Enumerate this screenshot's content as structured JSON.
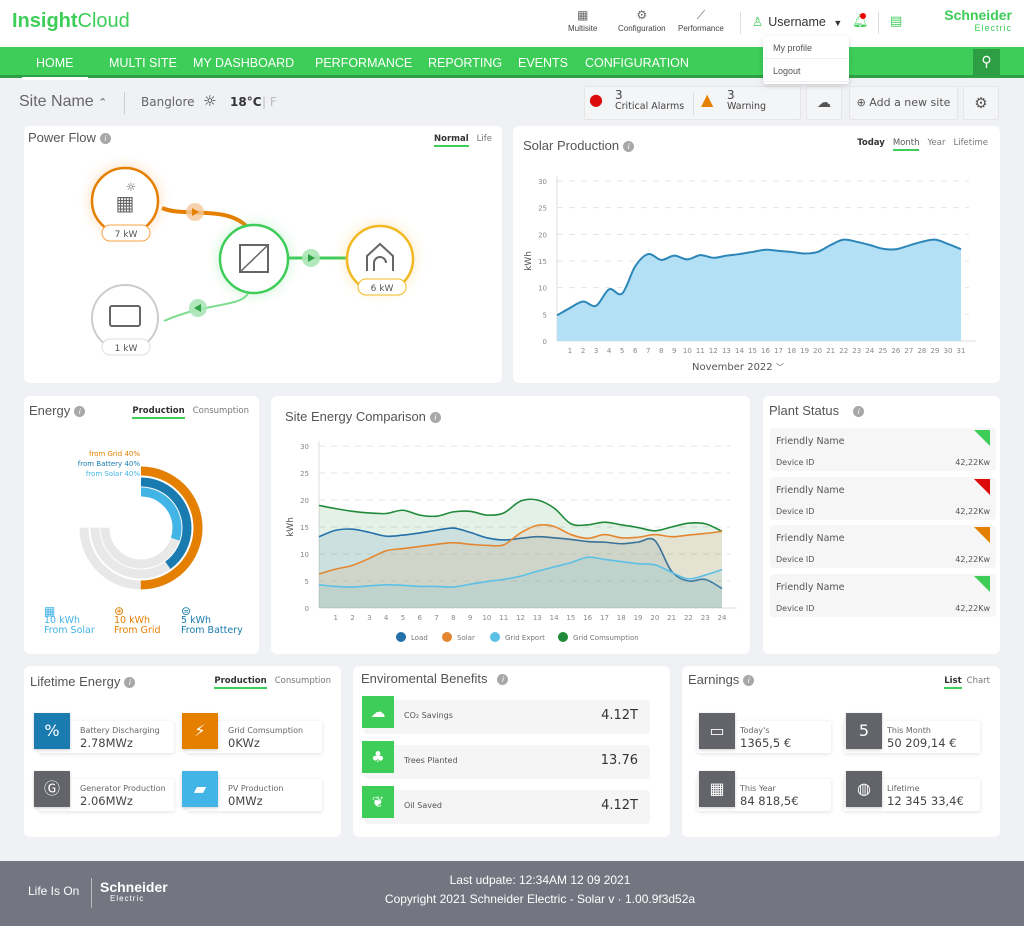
{
  "header": {
    "app_name_bold": "Insight",
    "app_name_light": "Cloud",
    "tools": [
      {
        "label": "Multisite",
        "icon": "multisite-icon"
      },
      {
        "label": "Configuration",
        "icon": "gear-icon"
      },
      {
        "label": "Performance",
        "icon": "chart-icon"
      }
    ],
    "username": "Username",
    "brand_top": "Schneider",
    "brand_bottom": "Electric",
    "user_menu": [
      "My profile",
      "Logout"
    ]
  },
  "nav": {
    "items": [
      "HOME",
      "MULTI SITE",
      "MY DASHBOARD",
      "PERFORMANCE",
      "REPORTING",
      "EVENTS",
      "CONFIGURATION"
    ],
    "active": "HOME"
  },
  "subbar": {
    "site_name": "Site Name",
    "city": "Banglore",
    "temperature": "18°C",
    "alt_unit": "| F",
    "critical_count": "3",
    "critical_label": "Critical Alarms",
    "warning_count": "3",
    "warning_label": "Warning",
    "add_site": "Add a new site"
  },
  "power_flow": {
    "title": "Power Flow",
    "tabs": [
      "Normal",
      "Life"
    ],
    "active_tab": "Normal",
    "solar": "7 kW",
    "home": "6 kW",
    "battery": "1 kW"
  },
  "solar_production": {
    "title": "Solar Production",
    "tabs": [
      "Today",
      "Month",
      "Year",
      "Lifetime"
    ],
    "active_tab": "Month",
    "period": "November 2022"
  },
  "energy": {
    "title": "Energy",
    "tabs": [
      "Production",
      "Consumption"
    ],
    "active_tab": "Production",
    "rings": [
      {
        "label": "40% from Grid",
        "percent": 50,
        "color": "#e47f00"
      },
      {
        "label": "40% from Battery",
        "percent": 40,
        "color": "#1a7bb0"
      },
      {
        "label": "40% from Solar",
        "percent": 30,
        "color": "#42b4e6"
      }
    ],
    "sources": [
      {
        "value": "10 kWh",
        "label": "From Solar",
        "color": "#42b4e6"
      },
      {
        "value": "10 kWh",
        "label": "From Grid",
        "color": "#e47f00"
      },
      {
        "value": "5 kWh",
        "label": "From Battery",
        "color": "#1a7bb0"
      }
    ]
  },
  "site_energy": {
    "title": "Site Energy Comparison"
  },
  "plant_status": {
    "title": "Plant Status",
    "items": [
      {
        "name": "Friendly Name",
        "device": "Device ID",
        "power": "42,22Kw",
        "status": "ok",
        "color": "#3dcd58"
      },
      {
        "name": "Friendly Name",
        "device": "Device ID",
        "power": "42,22Kw",
        "status": "error",
        "color": "#dc0a0a"
      },
      {
        "name": "Friendly Name",
        "device": "Device ID",
        "power": "42,22Kw",
        "status": "warning",
        "color": "#e47f00"
      },
      {
        "name": "Friendly Name",
        "device": "Device ID",
        "power": "42,22Kw",
        "status": "ok",
        "color": "#3dcd58"
      }
    ]
  },
  "lifetime_energy": {
    "title": "Lifetime Energy",
    "tabs": [
      "Production",
      "Consumption"
    ],
    "active_tab": "Production",
    "tiles": [
      {
        "label": "Battery Discharging",
        "value": "2.78MWz",
        "color": "#1a7bb0",
        "icon": "battery-percent-icon"
      },
      {
        "label": "Grid Comsumption",
        "value": "0KWz",
        "color": "#e47f00",
        "icon": "power-tower-icon"
      },
      {
        "label": "Generator Production",
        "value": "2.06MWz",
        "color": "#626469",
        "icon": "generator-icon"
      },
      {
        "label": "PV Production",
        "value": "0MWz",
        "color": "#42b4e6",
        "icon": "solar-panel-icon"
      }
    ]
  },
  "env_benefits": {
    "title": "Enviromental Benefits",
    "rows": [
      {
        "label": "CO₂ Savings",
        "value": "4.12T",
        "icon": "co2-factory-icon"
      },
      {
        "label": "Trees Planted",
        "value": "13.76",
        "icon": "tree-icon"
      },
      {
        "label": "Oil Saved",
        "value": "4.12T",
        "icon": "leaf-icon"
      }
    ]
  },
  "earnings": {
    "title": "Earnings",
    "tabs": [
      "List",
      "Chart"
    ],
    "active_tab": "List",
    "tiles": [
      {
        "label": "Today's",
        "value": "1365,5  €",
        "icon": "calendar-icon"
      },
      {
        "label": "This Month",
        "value": "50 209,14 €",
        "icon": "calendar-month-icon"
      },
      {
        "label": "This Year",
        "value": "84 818,5€",
        "icon": "grid-calendar-icon"
      },
      {
        "label": "Lifetime",
        "value": "12 345 33,4€",
        "icon": "globe-icon"
      }
    ]
  },
  "footer": {
    "tagline": "Life Is On",
    "brand_top": "Schneider",
    "brand_bottom": "Electric",
    "last_update": "Last udpate: 12:34AM 12 09 2021",
    "copyright": "Copyright 2021 Schneider Electric - Solar v · 1.00.9f3d52a"
  },
  "chart_data": [
    {
      "type": "area",
      "title": "Solar Production",
      "xlabel": "November 2022",
      "ylabel": "kWh",
      "ylim": [
        0,
        30
      ],
      "yticks": [
        0,
        5,
        10,
        15,
        20,
        25,
        30
      ],
      "grid": true,
      "x": [
        0,
        1,
        2,
        3,
        4,
        5,
        6,
        7,
        8,
        9,
        10,
        11,
        12,
        13,
        14,
        15,
        16,
        17,
        18,
        19,
        20,
        21,
        22,
        23,
        24,
        25,
        26,
        27,
        28,
        29,
        30,
        31
      ],
      "xticks": [
        1,
        2,
        3,
        4,
        5,
        6,
        7,
        8,
        9,
        10,
        11,
        12,
        13,
        14,
        15,
        16,
        17,
        18,
        19,
        20,
        21,
        22,
        23,
        24,
        25,
        26,
        27,
        28,
        29,
        30,
        31
      ],
      "series": [
        {
          "name": "Solar",
          "color": "#2d86b8",
          "fill": "#b3e0f5",
          "values": [
            4.8,
            6.2,
            7.4,
            6.6,
            9.7,
            8.9,
            14.0,
            16.3,
            15.2,
            16.0,
            15.3,
            16.1,
            15.6,
            16.0,
            16.3,
            16.7,
            17.1,
            16.9,
            16.7,
            16.4,
            16.7,
            18.0,
            19.0,
            18.6,
            18.0,
            17.3,
            17.2,
            17.9,
            18.6,
            19.0,
            18.2,
            17.2
          ]
        }
      ]
    },
    {
      "type": "area",
      "title": "Site Energy Comparison",
      "xlabel": "",
      "ylabel": "kWh",
      "ylim": [
        0,
        30
      ],
      "yticks": [
        0,
        5,
        10,
        15,
        20,
        25,
        30
      ],
      "grid": true,
      "legend": "bottom",
      "x": [
        0,
        1,
        2,
        3,
        4,
        5,
        6,
        7,
        8,
        9,
        10,
        11,
        12,
        13,
        14,
        15,
        16,
        17,
        18,
        19,
        20,
        21,
        22,
        23,
        24
      ],
      "xticks": [
        1,
        2,
        3,
        4,
        5,
        6,
        7,
        8,
        9,
        10,
        11,
        12,
        13,
        14,
        15,
        16,
        17,
        18,
        19,
        20,
        21,
        22,
        23,
        24
      ],
      "series": [
        {
          "name": "Grid Comsumption",
          "color": "#1f8a3a",
          "values": [
            19.0,
            18.4,
            17.9,
            17.6,
            17.5,
            18.1,
            17.2,
            17.0,
            17.8,
            17.9,
            17.2,
            17.6,
            19.8,
            20.0,
            18.5,
            15.6,
            15.4,
            15.9,
            15.4,
            14.9,
            14.3,
            15.0,
            15.7,
            15.6,
            14.2
          ]
        },
        {
          "name": "Load",
          "color": "#2470a8",
          "values": [
            13.2,
            14.4,
            14.6,
            14.0,
            13.3,
            13.5,
            13.9,
            14.4,
            14.8,
            14.0,
            13.0,
            12.6,
            12.9,
            13.2,
            13.0,
            12.7,
            12.3,
            12.2,
            11.9,
            12.2,
            12.5,
            6.8,
            5.0,
            5.3,
            3.6
          ]
        },
        {
          "name": "Solar",
          "color": "#e48630",
          "values": [
            6.3,
            7.2,
            7.9,
            9.2,
            10.6,
            11.0,
            11.4,
            11.8,
            12.1,
            11.8,
            11.6,
            11.7,
            13.9,
            15.3,
            15.1,
            13.6,
            12.9,
            13.6,
            13.0,
            13.1,
            13.6,
            13.2,
            13.5,
            13.8,
            14.2
          ]
        },
        {
          "name": "Grid Export",
          "color": "#5bc0e6",
          "values": [
            4.3,
            4.0,
            3.9,
            4.1,
            4.3,
            4.2,
            4.0,
            4.0,
            3.9,
            4.4,
            4.9,
            5.3,
            5.9,
            6.8,
            7.6,
            8.4,
            9.4,
            9.0,
            8.6,
            8.2,
            8.0,
            6.6,
            5.4,
            6.1,
            7.1
          ]
        }
      ]
    }
  ]
}
